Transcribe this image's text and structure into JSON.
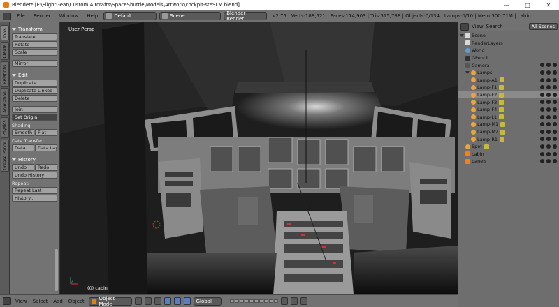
{
  "window": {
    "title": "Blender* [F:\\FlightGear\\Custom Aircrafts\\SpaceShuttle\\Models\\Artwork\\cockpit-steSLM.blend]"
  },
  "info_header": {
    "menus": [
      "File",
      "Render",
      "Window",
      "Help"
    ],
    "screen_layout": "Default",
    "scene": "Scene",
    "render_engine": "Blender Render",
    "stats": "v2.75 | Verts:188,521 | Faces:174,903 | Tris:315,788 | Objects:0/134 | Lamps:0/10 | Mem:300.71M | cabin"
  },
  "tool_tabs": [
    "Tools",
    "Create",
    "Relations",
    "Animation",
    "Physics",
    "Grease Pencil"
  ],
  "tool_shelf": {
    "transform_header": "Transform",
    "translate": "Translate",
    "rotate": "Rotate",
    "scale": "Scale",
    "mirror": "Mirror",
    "edit_header": "Edit",
    "duplicate": "Duplicate",
    "duplicate_linked": "Duplicate Linked",
    "delete": "Delete",
    "join": "Join",
    "set_origin": "Set Origin",
    "shading_label": "Shading:",
    "smooth": "Smooth",
    "flat": "Flat",
    "data_transfer_label": "Data Transfer:",
    "data": "Data",
    "data_layout": "Data Layo",
    "history_header": "History",
    "undo": "Undo",
    "redo": "Redo",
    "undo_history": "Undo History",
    "repeat_label": "Repeat:",
    "repeat_last": "Repeat Last",
    "history": "History..."
  },
  "viewport": {
    "label": "User Persp",
    "object_info": "(0) cabin"
  },
  "outliner": {
    "menus": [
      "View",
      "Search"
    ],
    "filter": "All Scenes",
    "items": [
      {
        "name": "Scene",
        "kind": "scene"
      },
      {
        "name": "RenderLayers",
        "kind": "scene"
      },
      {
        "name": "World",
        "kind": "world"
      },
      {
        "name": "GPencil",
        "kind": "gp"
      },
      {
        "name": "Camera",
        "kind": "cam"
      },
      {
        "name": "Lamps",
        "kind": "lamp"
      },
      {
        "name": "Lamp-A1",
        "kind": "lamp"
      },
      {
        "name": "Lamp-F1",
        "kind": "lamp"
      },
      {
        "name": "Lamp-F2",
        "kind": "lamp"
      },
      {
        "name": "Lamp-F3",
        "kind": "lamp"
      },
      {
        "name": "Lamp-F4",
        "kind": "lamp"
      },
      {
        "name": "Lamp-L1",
        "kind": "lamp"
      },
      {
        "name": "Lamp-M1",
        "kind": "lamp"
      },
      {
        "name": "Lamp-M2",
        "kind": "lamp"
      },
      {
        "name": "Lamp-R1",
        "kind": "lamp"
      },
      {
        "name": "Spot",
        "kind": "lamp"
      },
      {
        "name": "cabin",
        "kind": "mesh"
      },
      {
        "name": "panels",
        "kind": "mesh"
      }
    ]
  },
  "bottom_header": {
    "menus": [
      "View",
      "Select",
      "Add",
      "Object"
    ],
    "mode": "Object Mode",
    "orientation": "Global"
  },
  "colors": {
    "accent": "#5680c2",
    "lamp": "#e9a43c",
    "viewport_bg": "#1e1e1e"
  }
}
